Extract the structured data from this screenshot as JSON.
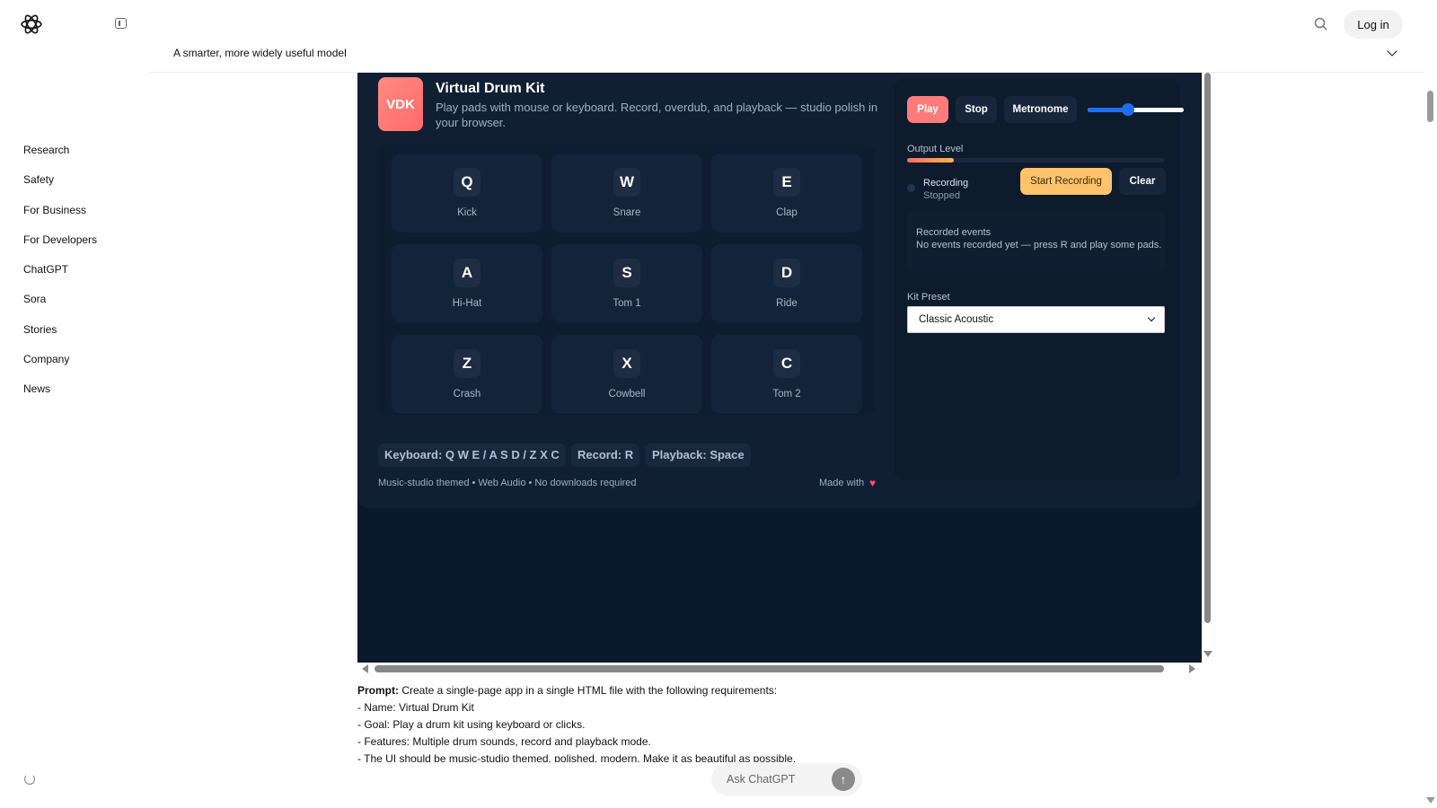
{
  "header": {
    "login_label": "Log in",
    "subtitle": "A smarter, more widely useful model"
  },
  "nav": {
    "items": [
      "Research",
      "Safety",
      "For Business",
      "For Developers",
      "ChatGPT",
      "Sora",
      "Stories",
      "Company",
      "News"
    ]
  },
  "app": {
    "badge": "VDK",
    "title": "Virtual Drum Kit",
    "description": "Play pads with mouse or keyboard. Record, overdub, and playback — studio polish in your browser.",
    "pads": [
      {
        "key": "Q",
        "name": "Kick"
      },
      {
        "key": "W",
        "name": "Snare"
      },
      {
        "key": "E",
        "name": "Clap"
      },
      {
        "key": "A",
        "name": "Hi-Hat"
      },
      {
        "key": "S",
        "name": "Tom 1"
      },
      {
        "key": "D",
        "name": "Ride"
      },
      {
        "key": "Z",
        "name": "Crash"
      },
      {
        "key": "X",
        "name": "Cowbell"
      },
      {
        "key": "C",
        "name": "Tom 2"
      }
    ],
    "chips": [
      "Keyboard: Q W E / A S D / Z X C",
      "Record: R",
      "Playback: Space"
    ],
    "footer_note": "Music-studio themed • Web Audio • No downloads required",
    "made_with": "Made with",
    "heart": "♥",
    "controls": {
      "play": "Play",
      "stop": "Stop",
      "metronome": "Metronome",
      "volume_level": 0.42,
      "output_label": "Output Level",
      "output_level": 0.18,
      "recording_label": "Recording",
      "recording_state": "Stopped",
      "start_recording": "Start Recording",
      "clear": "Clear",
      "events_title": "Recorded events",
      "events_empty": "No events recorded yet — press R and play some pads.",
      "kit_label": "Kit Preset",
      "kit_selected": "Classic Acoustic"
    },
    "colors": {
      "accent": "#ff7b7b",
      "record": "#ffc46b",
      "background": "#0a1a2e"
    }
  },
  "prompt": {
    "label": "Prompt:",
    "intro": " Create a single-page app in a single HTML file with the following requirements:",
    "lines": [
      "- Name: Virtual Drum Kit",
      "- Goal: Play a drum kit using keyboard or clicks.",
      "- Features: Multiple drum sounds, record and playback mode.",
      "- The UI should be music-studio themed, polished, modern. Make it as beautiful as possible."
    ]
  },
  "composer": {
    "placeholder": "Ask ChatGPT",
    "send_icon": "arrow-up-icon"
  }
}
